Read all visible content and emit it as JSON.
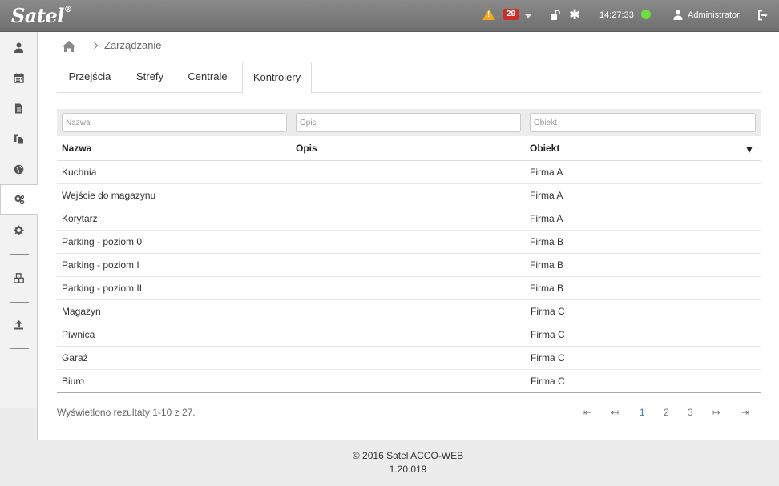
{
  "header": {
    "logo_text": "Satel",
    "logo_mark": "®",
    "alarm_count": "29",
    "time": "14:27:33",
    "user_name": "Administrator",
    "status_color": "#6be03c"
  },
  "sidebar": {
    "items": [
      {
        "icon": "user-icon"
      },
      {
        "icon": "calendar-icon"
      },
      {
        "icon": "document-icon"
      },
      {
        "icon": "copy-icon"
      },
      {
        "icon": "globe-icon"
      },
      {
        "icon": "gears-icon",
        "active": true
      },
      {
        "icon": "gear-icon"
      },
      {
        "icon": "cubes-icon"
      },
      {
        "icon": "upload-icon"
      }
    ]
  },
  "breadcrumb": {
    "current": "Zarządzanie"
  },
  "tabs": [
    {
      "label": "Przejścia"
    },
    {
      "label": "Strefy"
    },
    {
      "label": "Centrale"
    },
    {
      "label": "Kontrolery",
      "active": true
    }
  ],
  "filters": {
    "nazwa_placeholder": "Nazwa",
    "opis_placeholder": "Opis",
    "obiekt_placeholder": "Obiekt"
  },
  "table": {
    "columns": [
      "Nazwa",
      "Opis",
      "Obiekt"
    ],
    "rows": [
      {
        "nazwa": "Kuchnia",
        "opis": "",
        "obiekt": "Firma A"
      },
      {
        "nazwa": "Wejście do magazynu",
        "opis": "",
        "obiekt": "Firma A"
      },
      {
        "nazwa": "Korytarz",
        "opis": "",
        "obiekt": "Firma A"
      },
      {
        "nazwa": "Parking - poziom 0",
        "opis": "",
        "obiekt": "Firma B"
      },
      {
        "nazwa": "Parking - poziom I",
        "opis": "",
        "obiekt": "Firma B"
      },
      {
        "nazwa": "Parking - poziom II",
        "opis": "",
        "obiekt": "Firma B"
      },
      {
        "nazwa": "Magazyn",
        "opis": "",
        "obiekt": "Firma C"
      },
      {
        "nazwa": "Piwnica",
        "opis": "",
        "obiekt": "Firma C"
      },
      {
        "nazwa": "Garaż",
        "opis": "",
        "obiekt": "Firma C"
      },
      {
        "nazwa": "Biuro",
        "opis": "",
        "obiekt": "Firma C"
      }
    ]
  },
  "pagination": {
    "summary": "Wyświetlono rezultaty 1-10 z 27.",
    "first": "⇤",
    "prev": "↤",
    "pages": [
      "1",
      "2",
      "3"
    ],
    "next": "↦",
    "last": "⇥",
    "current_color": "#337ab7"
  },
  "footer": {
    "copyright": "© 2016 Satel",
    "product": "ACCO-WEB",
    "version": "1.20.019"
  }
}
